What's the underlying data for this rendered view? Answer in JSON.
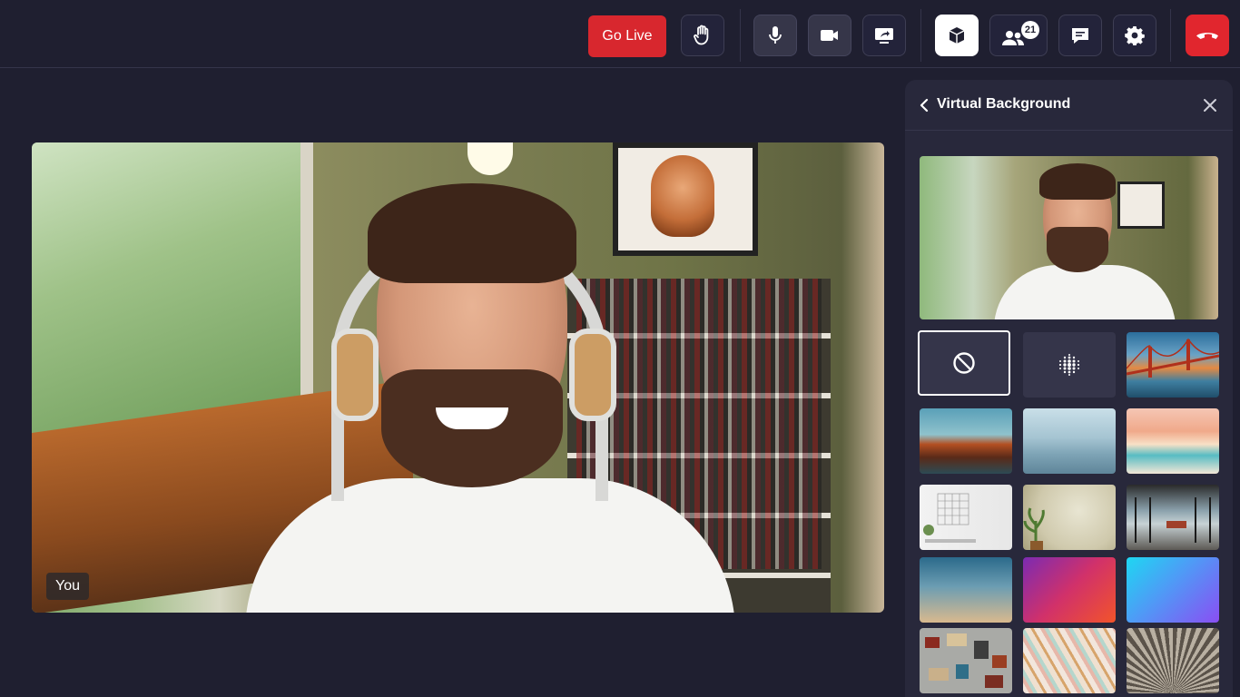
{
  "toolbar": {
    "go_live_label": "Go Live",
    "participants_count": "21",
    "icons": {
      "raise_hand": "hand-icon",
      "microphone": "microphone-icon",
      "camera": "video-camera-icon",
      "screen_share": "screen-share-icon",
      "virtual_background": "cube-icon",
      "participants": "people-icon",
      "chat": "chat-icon",
      "settings": "gear-icon",
      "leave": "phone-hangup-icon"
    },
    "colors": {
      "live": "#d8272e",
      "leave": "#e1262e"
    }
  },
  "video": {
    "self_label": "You"
  },
  "panel": {
    "title": "Virtual Background",
    "backgrounds": [
      {
        "id": "none",
        "kind": "option",
        "icon": "no-background-icon",
        "selected": true
      },
      {
        "id": "blur",
        "kind": "option",
        "icon": "blur-icon",
        "selected": false
      },
      {
        "id": "golden-gate",
        "kind": "image",
        "selected": false
      },
      {
        "id": "mountain-sunrise",
        "kind": "image",
        "selected": false
      },
      {
        "id": "misty-mountains",
        "kind": "image",
        "selected": false
      },
      {
        "id": "beach-sunset",
        "kind": "image",
        "selected": false
      },
      {
        "id": "white-room",
        "kind": "image",
        "selected": false
      },
      {
        "id": "beige-wall-plant",
        "kind": "image",
        "selected": false
      },
      {
        "id": "office-glass",
        "kind": "image",
        "selected": false
      },
      {
        "id": "teal-dusk-gradient",
        "kind": "image",
        "selected": false
      },
      {
        "id": "pink-orange-gradient",
        "kind": "image",
        "selected": false
      },
      {
        "id": "cyan-purple-gradient",
        "kind": "image",
        "selected": false
      },
      {
        "id": "poster-wall",
        "kind": "image",
        "selected": false
      },
      {
        "id": "pastel-paint",
        "kind": "image",
        "selected": false
      },
      {
        "id": "circular-ceiling",
        "kind": "image",
        "selected": false
      }
    ]
  }
}
